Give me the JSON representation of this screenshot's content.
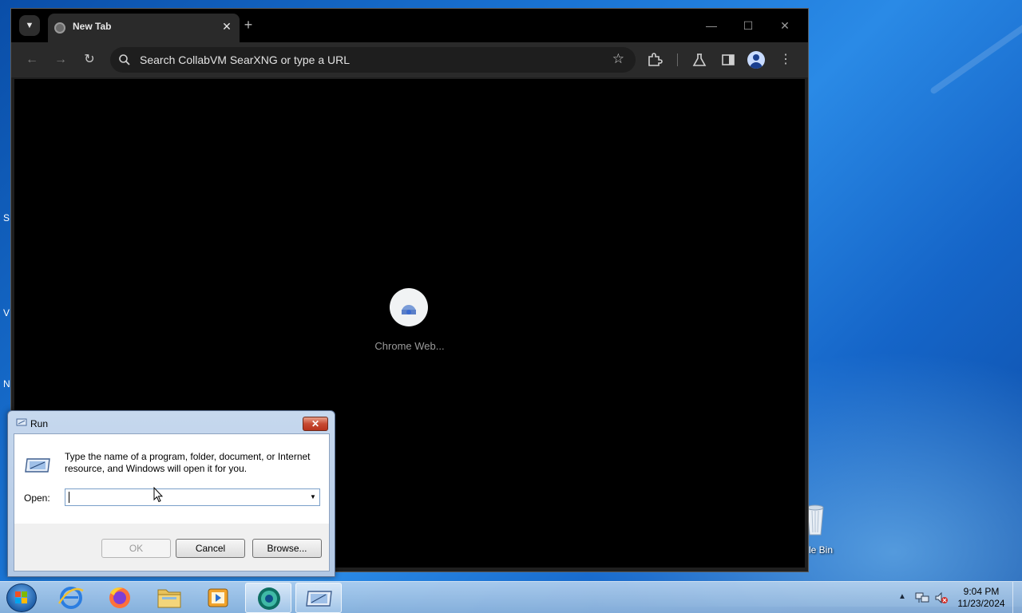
{
  "desktop": {
    "edge_letters": [
      "S",
      "V",
      "N"
    ],
    "recycle_bin_label": "le Bin"
  },
  "browser": {
    "tab_title": "New Tab",
    "new_tab_symbol": "+",
    "tab_close_symbol": "✕",
    "omnibox_placeholder": "Search CollabVM SearXNG or type a URL",
    "shortcut_label": "Chrome Web..."
  },
  "run_dialog": {
    "title": "Run",
    "close_symbol": "✕",
    "description": "Type the name of a program, folder, document, or Internet resource, and Windows will open it for you.",
    "open_label": "Open:",
    "open_value": "",
    "ok_label": "OK",
    "cancel_label": "Cancel",
    "browse_label": "Browse..."
  },
  "taskbar": {
    "pinned": [
      "start-orb",
      "internet-explorer-icon",
      "firefox-icon",
      "file-explorer-icon",
      "media-player-icon",
      "chrome-icon",
      "run-icon"
    ],
    "clock_time": "9:04 PM",
    "clock_date": "11/23/2024"
  },
  "colors": {
    "chrome_toolbar": "#2a2a2a",
    "chrome_tabstrip": "#000000",
    "run_close": "#c74a32",
    "desktop_blue": "#1a74d4"
  }
}
